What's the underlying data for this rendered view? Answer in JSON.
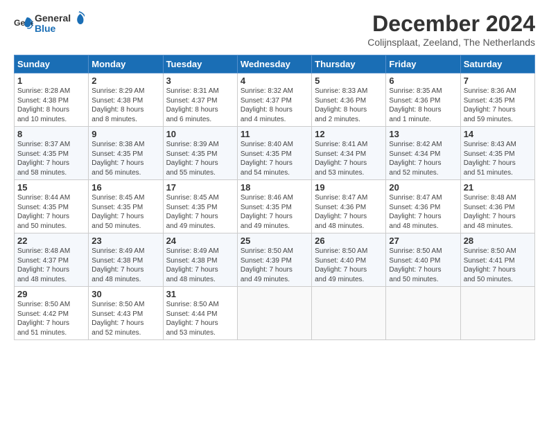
{
  "logo": {
    "line1": "General",
    "line2": "Blue"
  },
  "title": "December 2024",
  "subtitle": "Colijnsplaat, Zeeland, The Netherlands",
  "weekdays": [
    "Sunday",
    "Monday",
    "Tuesday",
    "Wednesday",
    "Thursday",
    "Friday",
    "Saturday"
  ],
  "weeks": [
    [
      {
        "day": "1",
        "info": "Sunrise: 8:28 AM\nSunset: 4:38 PM\nDaylight: 8 hours\nand 10 minutes."
      },
      {
        "day": "2",
        "info": "Sunrise: 8:29 AM\nSunset: 4:38 PM\nDaylight: 8 hours\nand 8 minutes."
      },
      {
        "day": "3",
        "info": "Sunrise: 8:31 AM\nSunset: 4:37 PM\nDaylight: 8 hours\nand 6 minutes."
      },
      {
        "day": "4",
        "info": "Sunrise: 8:32 AM\nSunset: 4:37 PM\nDaylight: 8 hours\nand 4 minutes."
      },
      {
        "day": "5",
        "info": "Sunrise: 8:33 AM\nSunset: 4:36 PM\nDaylight: 8 hours\nand 2 minutes."
      },
      {
        "day": "6",
        "info": "Sunrise: 8:35 AM\nSunset: 4:36 PM\nDaylight: 8 hours\nand 1 minute."
      },
      {
        "day": "7",
        "info": "Sunrise: 8:36 AM\nSunset: 4:35 PM\nDaylight: 7 hours\nand 59 minutes."
      }
    ],
    [
      {
        "day": "8",
        "info": "Sunrise: 8:37 AM\nSunset: 4:35 PM\nDaylight: 7 hours\nand 58 minutes."
      },
      {
        "day": "9",
        "info": "Sunrise: 8:38 AM\nSunset: 4:35 PM\nDaylight: 7 hours\nand 56 minutes."
      },
      {
        "day": "10",
        "info": "Sunrise: 8:39 AM\nSunset: 4:35 PM\nDaylight: 7 hours\nand 55 minutes."
      },
      {
        "day": "11",
        "info": "Sunrise: 8:40 AM\nSunset: 4:35 PM\nDaylight: 7 hours\nand 54 minutes."
      },
      {
        "day": "12",
        "info": "Sunrise: 8:41 AM\nSunset: 4:34 PM\nDaylight: 7 hours\nand 53 minutes."
      },
      {
        "day": "13",
        "info": "Sunrise: 8:42 AM\nSunset: 4:34 PM\nDaylight: 7 hours\nand 52 minutes."
      },
      {
        "day": "14",
        "info": "Sunrise: 8:43 AM\nSunset: 4:35 PM\nDaylight: 7 hours\nand 51 minutes."
      }
    ],
    [
      {
        "day": "15",
        "info": "Sunrise: 8:44 AM\nSunset: 4:35 PM\nDaylight: 7 hours\nand 50 minutes."
      },
      {
        "day": "16",
        "info": "Sunrise: 8:45 AM\nSunset: 4:35 PM\nDaylight: 7 hours\nand 50 minutes."
      },
      {
        "day": "17",
        "info": "Sunrise: 8:45 AM\nSunset: 4:35 PM\nDaylight: 7 hours\nand 49 minutes."
      },
      {
        "day": "18",
        "info": "Sunrise: 8:46 AM\nSunset: 4:35 PM\nDaylight: 7 hours\nand 49 minutes."
      },
      {
        "day": "19",
        "info": "Sunrise: 8:47 AM\nSunset: 4:36 PM\nDaylight: 7 hours\nand 48 minutes."
      },
      {
        "day": "20",
        "info": "Sunrise: 8:47 AM\nSunset: 4:36 PM\nDaylight: 7 hours\nand 48 minutes."
      },
      {
        "day": "21",
        "info": "Sunrise: 8:48 AM\nSunset: 4:36 PM\nDaylight: 7 hours\nand 48 minutes."
      }
    ],
    [
      {
        "day": "22",
        "info": "Sunrise: 8:48 AM\nSunset: 4:37 PM\nDaylight: 7 hours\nand 48 minutes."
      },
      {
        "day": "23",
        "info": "Sunrise: 8:49 AM\nSunset: 4:38 PM\nDaylight: 7 hours\nand 48 minutes."
      },
      {
        "day": "24",
        "info": "Sunrise: 8:49 AM\nSunset: 4:38 PM\nDaylight: 7 hours\nand 48 minutes."
      },
      {
        "day": "25",
        "info": "Sunrise: 8:50 AM\nSunset: 4:39 PM\nDaylight: 7 hours\nand 49 minutes."
      },
      {
        "day": "26",
        "info": "Sunrise: 8:50 AM\nSunset: 4:40 PM\nDaylight: 7 hours\nand 49 minutes."
      },
      {
        "day": "27",
        "info": "Sunrise: 8:50 AM\nSunset: 4:40 PM\nDaylight: 7 hours\nand 50 minutes."
      },
      {
        "day": "28",
        "info": "Sunrise: 8:50 AM\nSunset: 4:41 PM\nDaylight: 7 hours\nand 50 minutes."
      }
    ],
    [
      {
        "day": "29",
        "info": "Sunrise: 8:50 AM\nSunset: 4:42 PM\nDaylight: 7 hours\nand 51 minutes."
      },
      {
        "day": "30",
        "info": "Sunrise: 8:50 AM\nSunset: 4:43 PM\nDaylight: 7 hours\nand 52 minutes."
      },
      {
        "day": "31",
        "info": "Sunrise: 8:50 AM\nSunset: 4:44 PM\nDaylight: 7 hours\nand 53 minutes."
      },
      {
        "day": "",
        "info": ""
      },
      {
        "day": "",
        "info": ""
      },
      {
        "day": "",
        "info": ""
      },
      {
        "day": "",
        "info": ""
      }
    ]
  ]
}
